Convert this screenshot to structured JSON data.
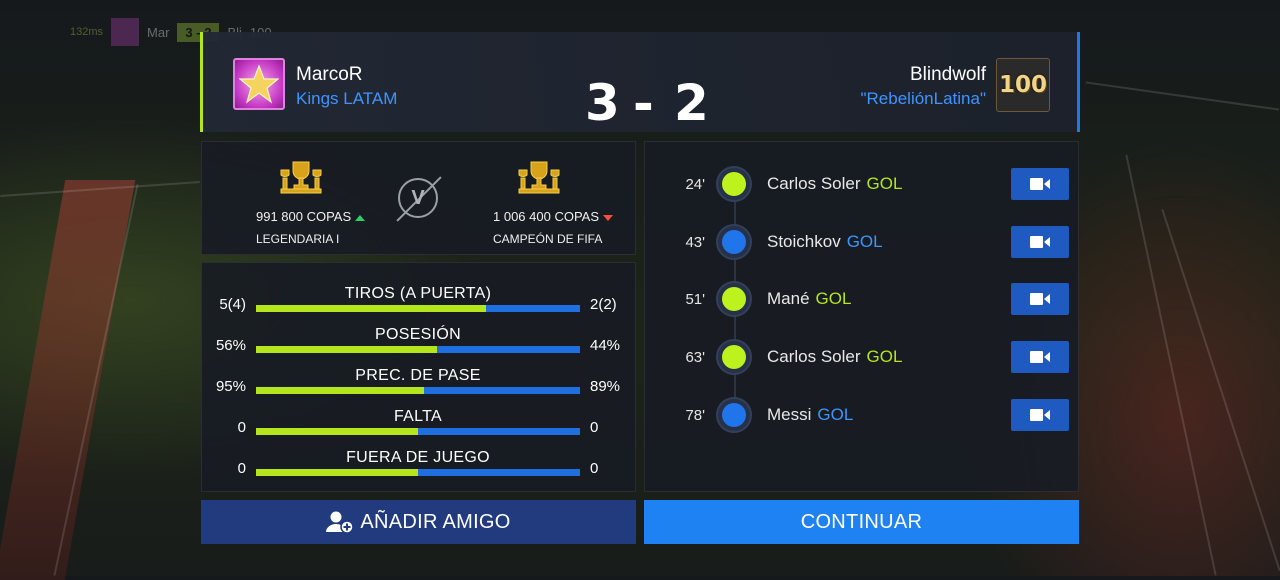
{
  "background": {
    "hud": {
      "ping": "132ms",
      "home_abbr": "Mar",
      "score": "3 - 2",
      "away_abbr": "Bli",
      "rating": "100"
    }
  },
  "header": {
    "home": {
      "name": "MarcoR",
      "club": "Kings LATAM"
    },
    "away": {
      "name": "Blindwolf",
      "club": "\"RebeliónLatina\"",
      "badge": "100"
    },
    "score_home": "3",
    "score_separator": "-",
    "score_away": "2"
  },
  "cups": {
    "home": {
      "count": "991 800 COPAS",
      "tier": "LEGENDARIA I",
      "trend": "up"
    },
    "vs_label": "V",
    "away": {
      "count": "1 006 400 COPAS",
      "tier": "CAMPEÓN DE FIFA",
      "trend": "down"
    }
  },
  "stats": [
    {
      "label": "TIROS (A PUERTA)",
      "home": "5(4)",
      "away": "2(2)",
      "home_share": 0.71
    },
    {
      "label": "POSESIÓN",
      "home": "56%",
      "away": "44%",
      "home_share": 0.56
    },
    {
      "label": "PREC. DE PASE",
      "home": "95%",
      "away": "89%",
      "home_share": 0.52
    },
    {
      "label": "FALTA",
      "home": "0",
      "away": "0",
      "home_share": 0.5
    },
    {
      "label": "FUERA DE JUEGO",
      "home": "0",
      "away": "0",
      "home_share": 0.5
    }
  ],
  "events": [
    {
      "minute": "24'",
      "player": "Carlos Soler",
      "type": "GOL",
      "team": "home"
    },
    {
      "minute": "43'",
      "player": "Stoichkov",
      "type": "GOL",
      "team": "away"
    },
    {
      "minute": "51'",
      "player": "Mané",
      "type": "GOL",
      "team": "home"
    },
    {
      "minute": "63'",
      "player": "Carlos Soler",
      "type": "GOL",
      "team": "home"
    },
    {
      "minute": "78'",
      "player": "Messi",
      "type": "GOL",
      "team": "away"
    }
  ],
  "buttons": {
    "add_friend": "AÑADIR AMIGO",
    "continue": "CONTINUAR"
  },
  "colors": {
    "home": "#b5e61d",
    "away": "#1f6fe0",
    "club_text": "#3d95ff",
    "continue_button": "#1f82f2",
    "friend_button": "#213b7e"
  },
  "icons": {
    "home_avatar": "star-icon",
    "trophy": "trophy-icon",
    "event": "ball-icon",
    "replay": "video-camera-icon",
    "add_friend": "add-user-icon"
  }
}
